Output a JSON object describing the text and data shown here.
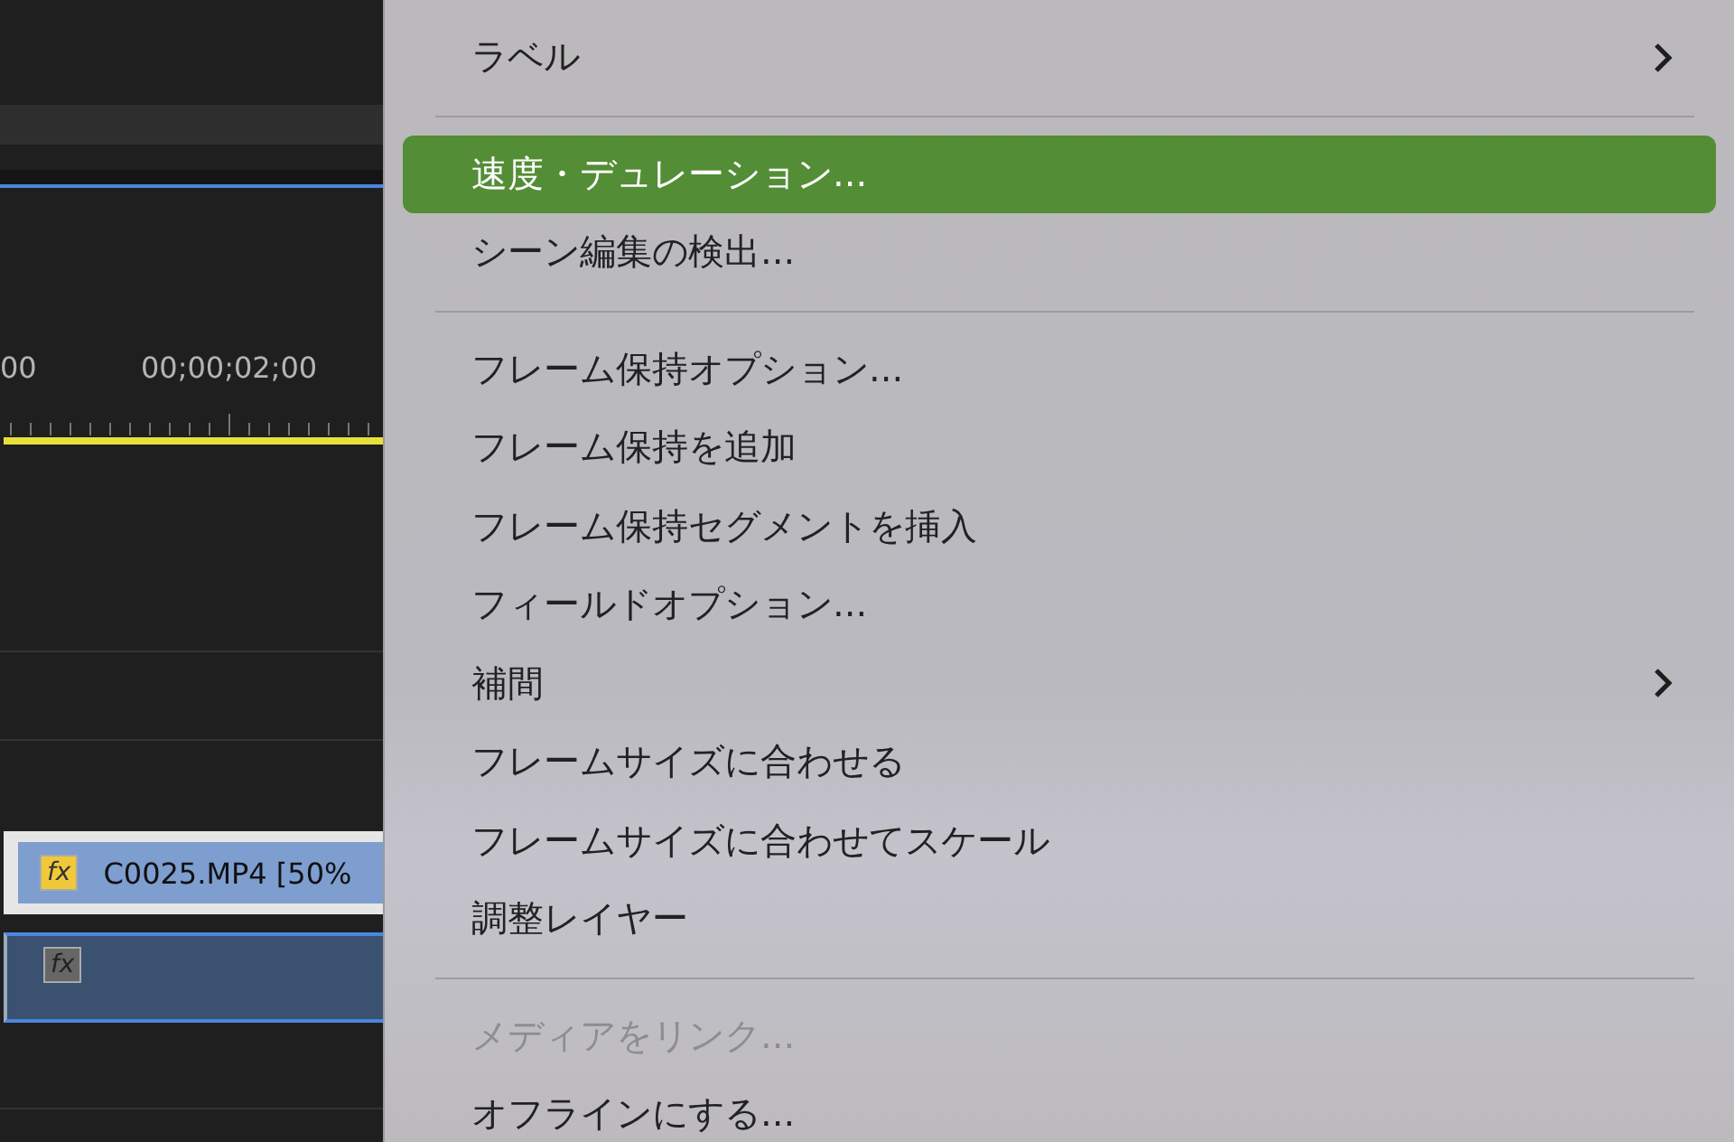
{
  "timeline": {
    "timecodes": [
      "00",
      "00;00;02;00"
    ],
    "video_clip": {
      "name": "C0025.MP4 [50%",
      "fx": "fx"
    },
    "audio_clip": {
      "fx": "fx"
    }
  },
  "context_menu": {
    "items": [
      {
        "kind": "item",
        "label": "ラベル",
        "submenu": true,
        "selected": false,
        "disabled": false
      },
      {
        "kind": "separator"
      },
      {
        "kind": "item",
        "label": "速度・デュレーション...",
        "submenu": false,
        "selected": true,
        "disabled": false
      },
      {
        "kind": "item",
        "label": "シーン編集の検出...",
        "submenu": false,
        "selected": false,
        "disabled": false
      },
      {
        "kind": "separator"
      },
      {
        "kind": "item",
        "label": "フレーム保持オプション...",
        "submenu": false,
        "selected": false,
        "disabled": false
      },
      {
        "kind": "item",
        "label": "フレーム保持を追加",
        "submenu": false,
        "selected": false,
        "disabled": false
      },
      {
        "kind": "item",
        "label": "フレーム保持セグメントを挿入",
        "submenu": false,
        "selected": false,
        "disabled": false
      },
      {
        "kind": "item",
        "label": "フィールドオプション...",
        "submenu": false,
        "selected": false,
        "disabled": false
      },
      {
        "kind": "item",
        "label": "補間",
        "submenu": true,
        "selected": false,
        "disabled": false
      },
      {
        "kind": "item",
        "label": "フレームサイズに合わせる",
        "submenu": false,
        "selected": false,
        "disabled": false
      },
      {
        "kind": "item",
        "label": "フレームサイズに合わせてスケール",
        "submenu": false,
        "selected": false,
        "disabled": false
      },
      {
        "kind": "item",
        "label": "調整レイヤー",
        "submenu": false,
        "selected": false,
        "disabled": false
      },
      {
        "kind": "separator"
      },
      {
        "kind": "item",
        "label": "メディアをリンク...",
        "submenu": false,
        "selected": false,
        "disabled": true
      },
      {
        "kind": "item",
        "label": "オフラインにする...",
        "submenu": false,
        "selected": false,
        "disabled": false
      }
    ]
  }
}
